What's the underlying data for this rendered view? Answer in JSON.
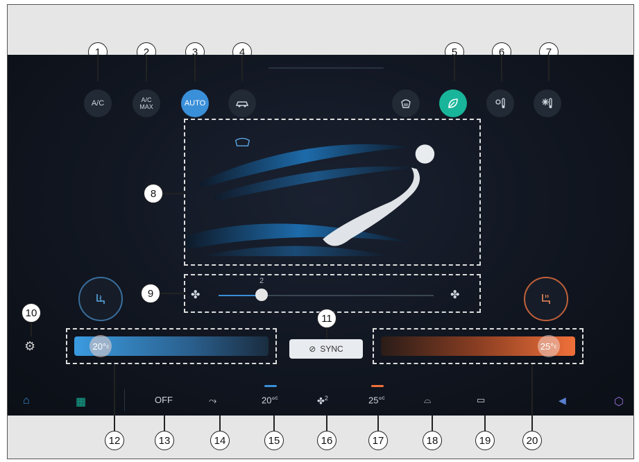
{
  "callouts": [
    "1",
    "2",
    "3",
    "4",
    "5",
    "6",
    "7",
    "8",
    "9",
    "10",
    "11",
    "12",
    "13",
    "14",
    "15",
    "16",
    "17",
    "18",
    "19",
    "20"
  ],
  "top_buttons": {
    "ac": "A/C",
    "ac_max_line1": "A/C",
    "ac_max_line2": "MAX",
    "auto": "AUTO"
  },
  "fan": {
    "speed": "2",
    "level_fraction": 0.2
  },
  "sync": {
    "label": "SYNC"
  },
  "temps": {
    "left": "20°",
    "left_unit": "c",
    "right": "25°",
    "right_unit": "c",
    "left_fraction": 0.08,
    "right_fraction": 0.92
  },
  "bottom": {
    "off": "OFF",
    "left_temp": "20°",
    "left_temp_unit": "c",
    "fan_speed": "2",
    "right_temp": "25°",
    "right_temp_unit": "c"
  },
  "colors": {
    "accent_blue": "#3a8fd9",
    "eco_green": "#19b59a",
    "heat_orange": "#f0703a"
  },
  "icons": [
    "car-icon",
    "defrost-front-icon",
    "leaf-icon",
    "sun-temp-icon",
    "snow-temp-icon",
    "fan-icon",
    "seat-ventilation-icon",
    "seat-heat-icon",
    "gear-icon",
    "sync-icon",
    "air-flow-icon",
    "defrost-rear-icon",
    "home-icon",
    "apps-icon",
    "volume-icon",
    "hexagon-icon"
  ]
}
